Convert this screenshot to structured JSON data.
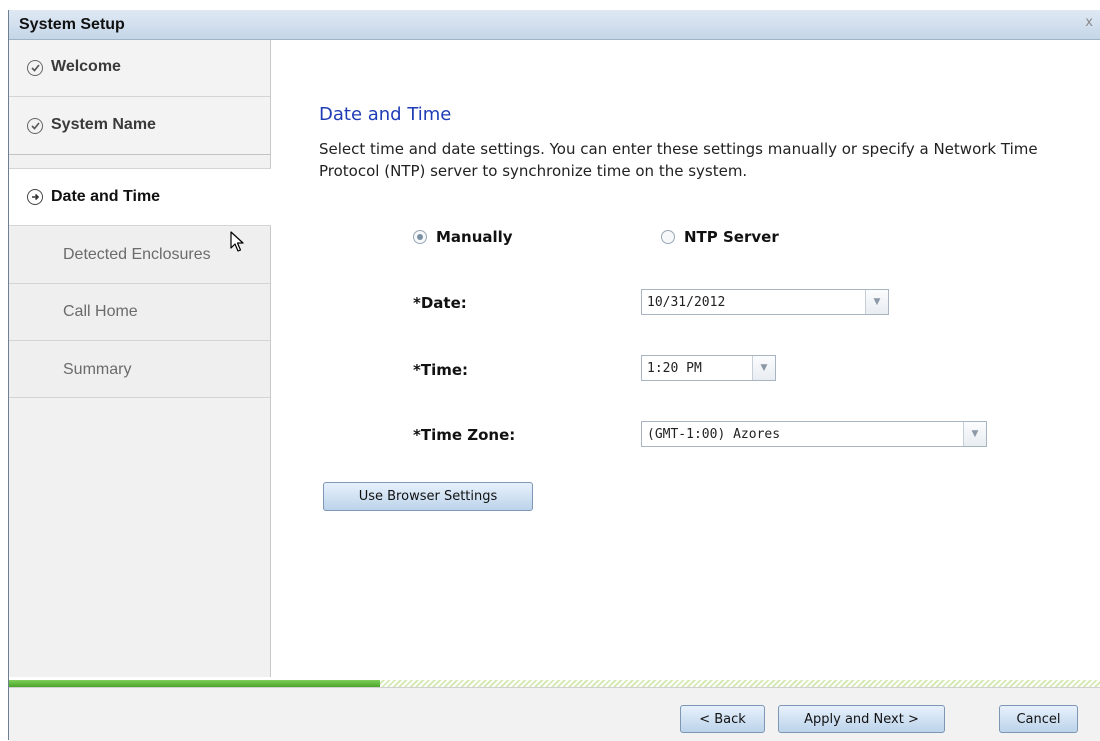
{
  "window": {
    "title": "System Setup",
    "close_glyph": "x"
  },
  "sidebar": {
    "items": [
      {
        "label": "Welcome",
        "state": "done",
        "icon": "check-circle-icon"
      },
      {
        "label": "System Name",
        "state": "done",
        "icon": "check-circle-icon"
      },
      {
        "label": "Date and Time",
        "state": "active",
        "icon": "arrow-circle-icon"
      },
      {
        "label": "Detected Enclosures",
        "state": "pending"
      },
      {
        "label": "Call Home",
        "state": "pending"
      },
      {
        "label": "Summary",
        "state": "pending"
      }
    ]
  },
  "main": {
    "heading": "Date and Time",
    "description": "Select time and date settings. You can enter these settings manually or specify a Network Time Protocol (NTP) server to synchronize time on the system.",
    "mode_options": [
      {
        "label": "Manually",
        "selected": true
      },
      {
        "label": "NTP Server",
        "selected": false
      }
    ],
    "fields": {
      "date": {
        "label": "*Date:",
        "value": "10/31/2012"
      },
      "time": {
        "label": "*Time:",
        "value": "1:20 PM"
      },
      "timezone": {
        "label": "*Time Zone:",
        "value": "(GMT-1:00) Azores"
      }
    },
    "browser_settings_button": "Use Browser Settings"
  },
  "progress": {
    "fraction": 0.34,
    "colors": {
      "fill": "#4aa52a",
      "track": "#d6eab8"
    }
  },
  "footer": {
    "back": "< Back",
    "apply_next": "Apply and Next >",
    "cancel": "Cancel"
  },
  "colors": {
    "heading": "#1f3db5",
    "button_border": "#7d97b4"
  }
}
